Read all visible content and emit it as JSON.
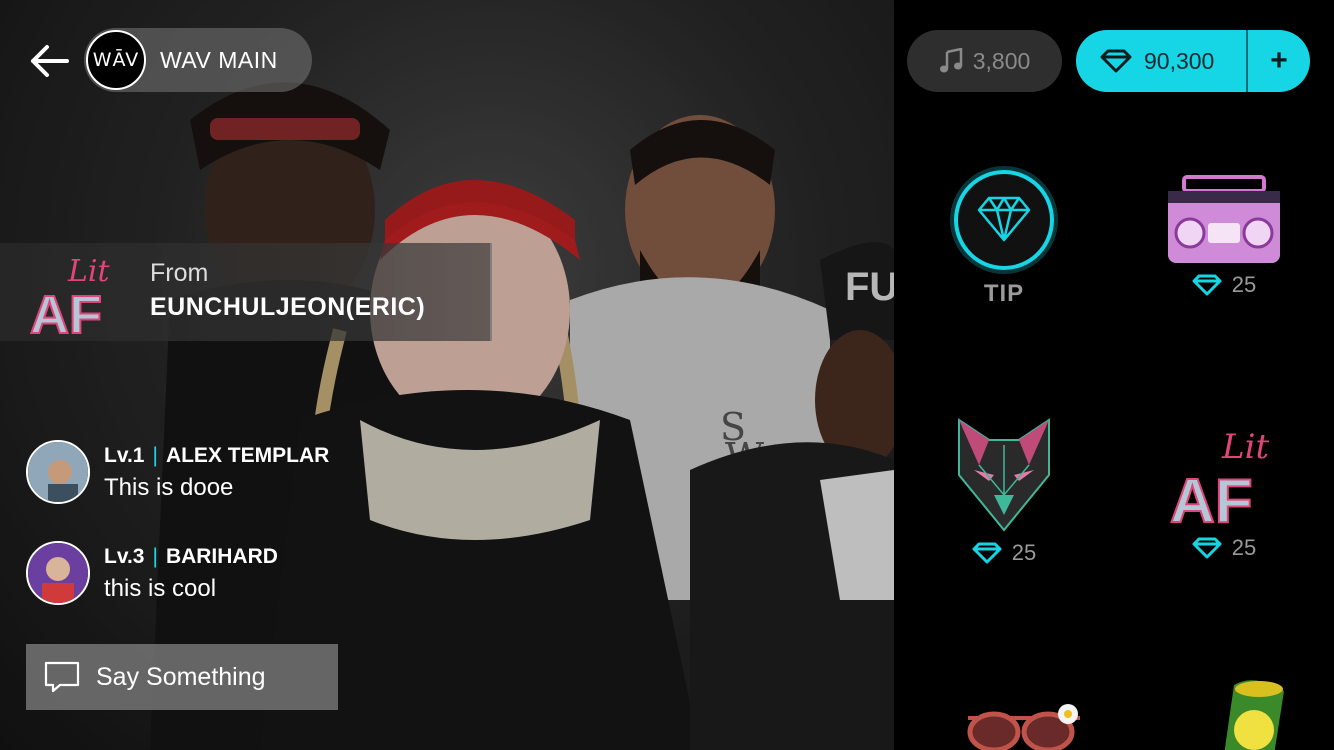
{
  "header": {
    "channel_logo_text": "WĀV",
    "channel_name": "WAV MAIN"
  },
  "gift_banner": {
    "from_label": "From",
    "sender": "EUNCHULJEON(ERIC)",
    "sticker_text_small": "Lit",
    "sticker_text_big": "AF"
  },
  "chat": [
    {
      "level": "Lv.1",
      "user": "ALEX TEMPLAR",
      "message": "This is dooe"
    },
    {
      "level": "Lv.3",
      "user": "BARIHARD",
      "message": "this is cool"
    }
  ],
  "input": {
    "placeholder": "Say Something"
  },
  "wallet": {
    "notes": "3,800",
    "gems": "90,300",
    "add_label": "+"
  },
  "store": {
    "tip_label": "TIP",
    "items": [
      {
        "name": "boombox",
        "price": "25"
      },
      {
        "name": "wolf",
        "price": "25"
      },
      {
        "name": "lit-af",
        "price": "25",
        "text_small": "Lit",
        "text_big": "AF"
      }
    ]
  },
  "colors": {
    "accent": "#16d6e6",
    "pink": "#e0457a"
  }
}
